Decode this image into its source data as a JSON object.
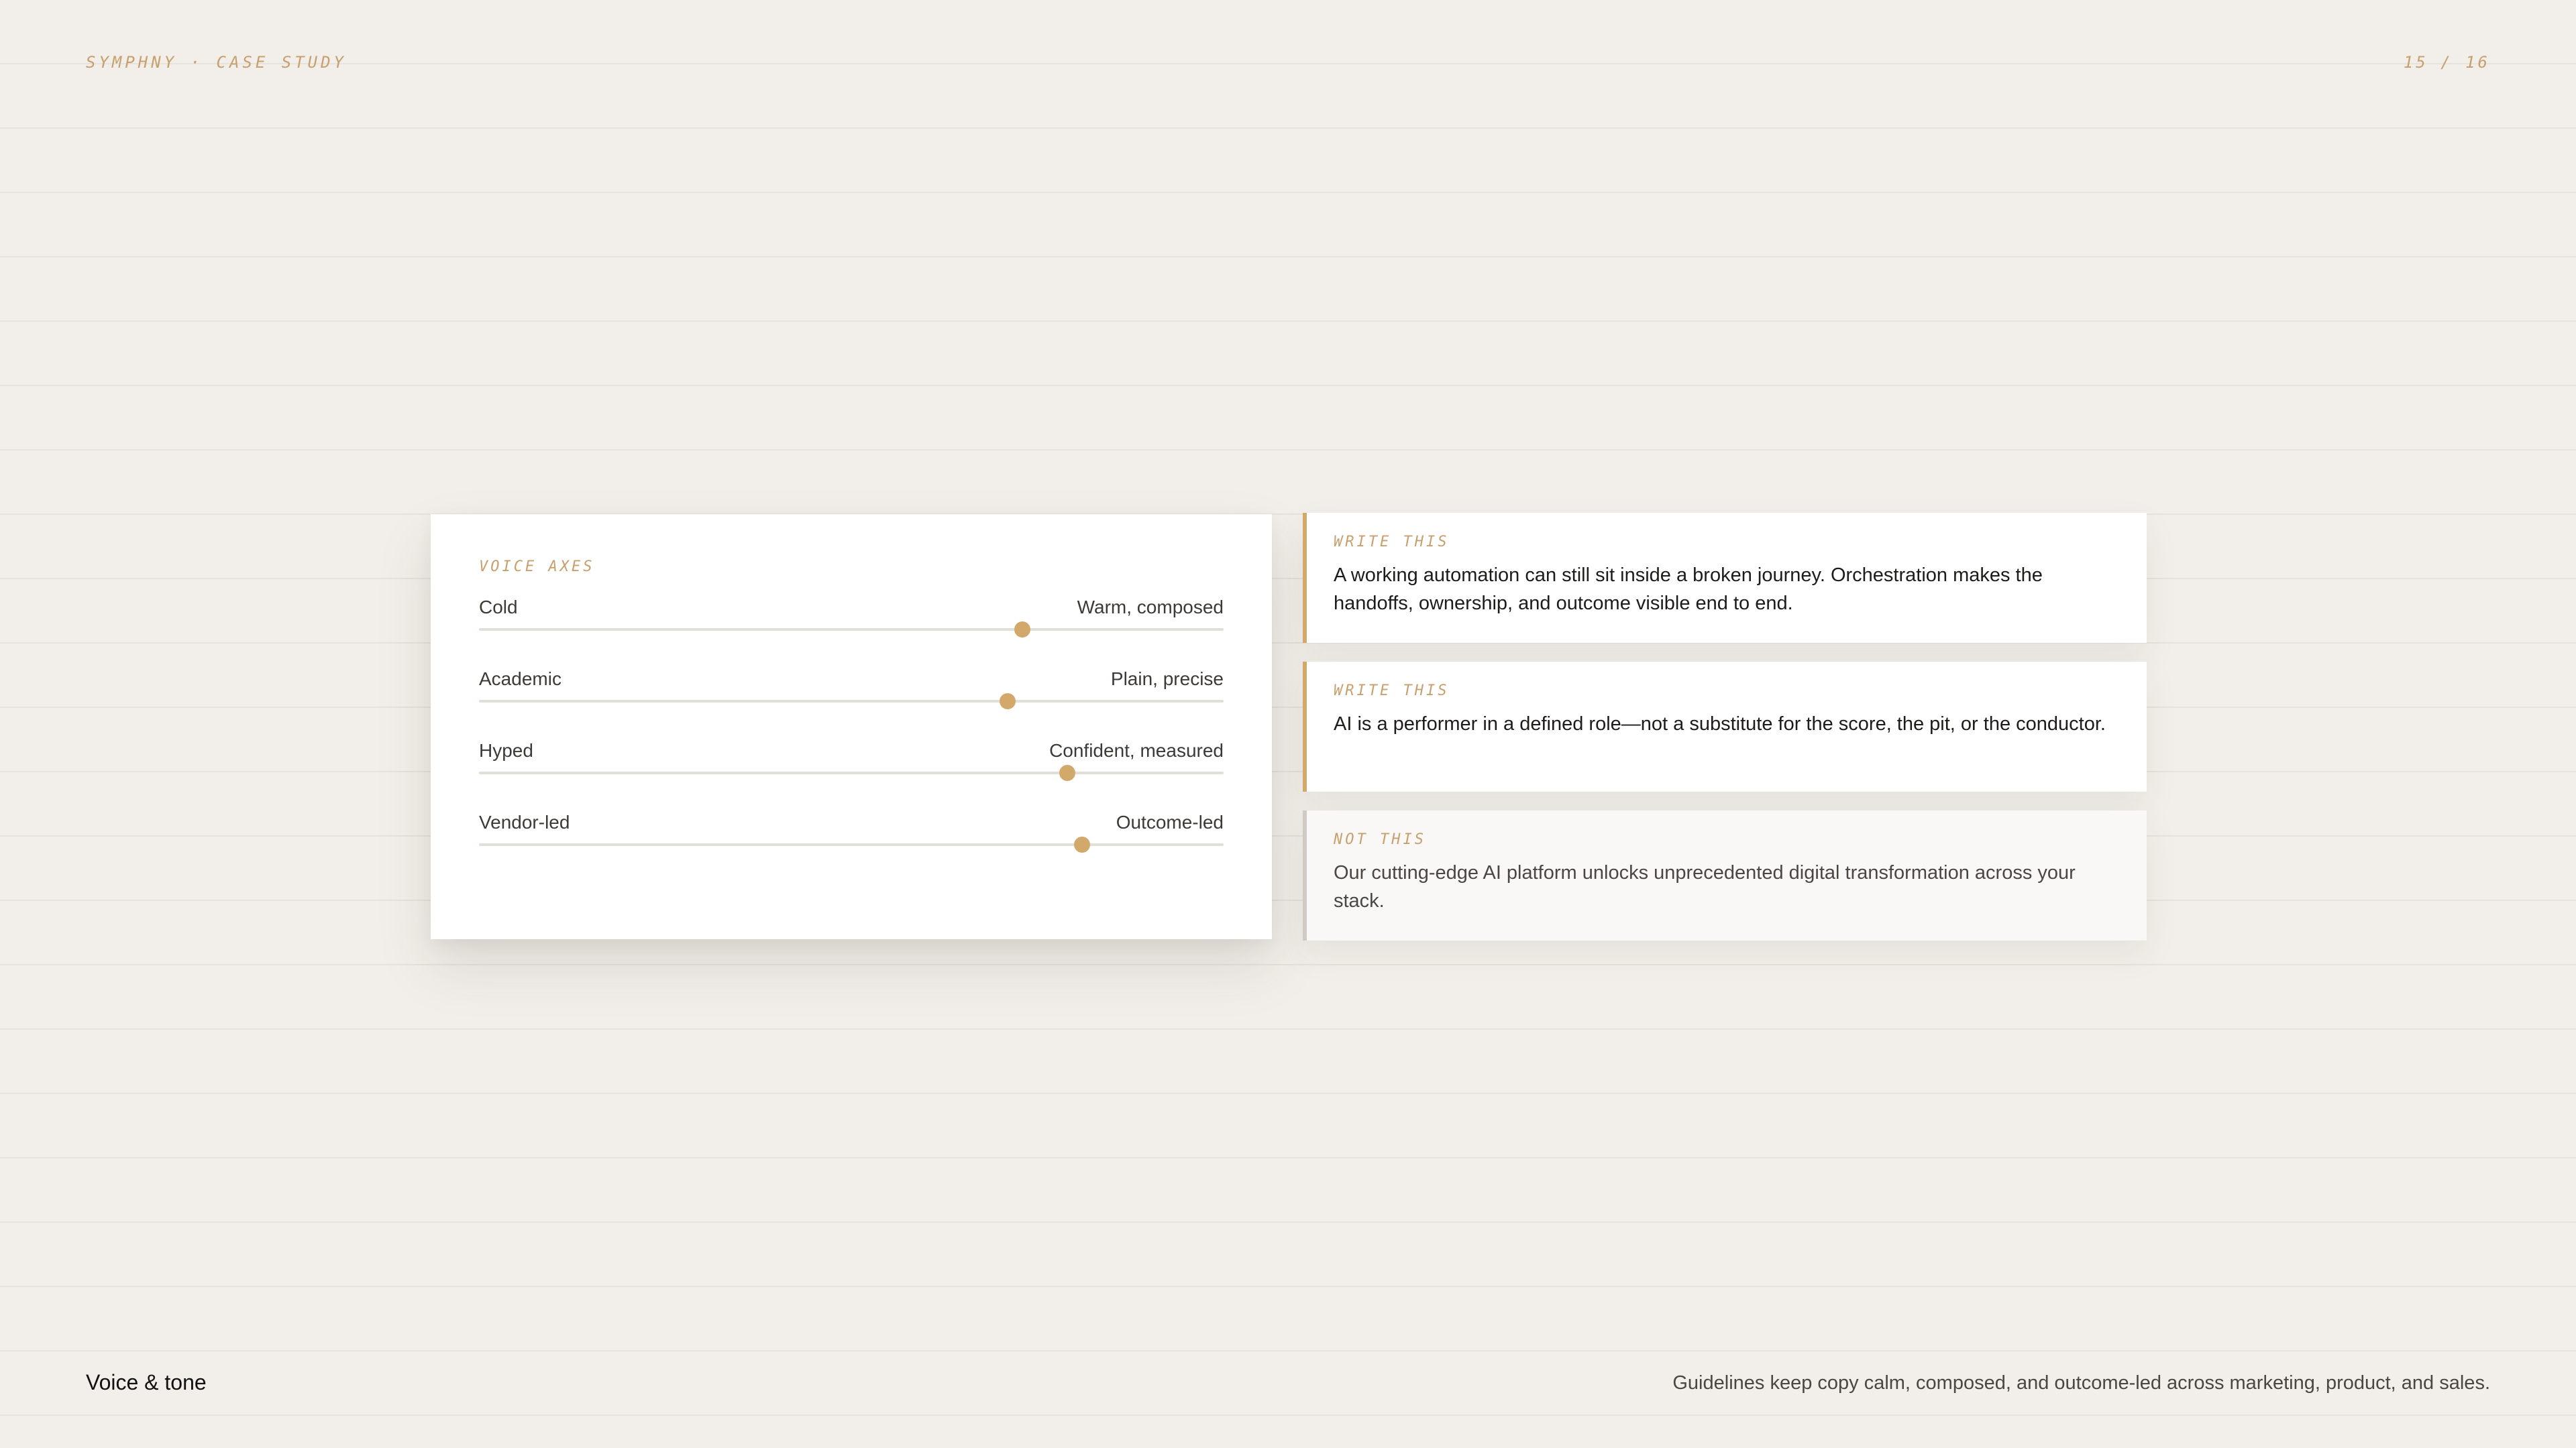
{
  "header": {
    "deck_label": "SYMPHNY · CASE STUDY",
    "page_indicator": "15 / 16"
  },
  "voice_axes": {
    "label": "VOICE AXES",
    "axes": [
      {
        "left": "Cold",
        "right": "Warm, composed",
        "value": 0.73
      },
      {
        "left": "Academic",
        "right": "Plain, precise",
        "value": 0.71
      },
      {
        "left": "Hyped",
        "right": "Confident, measured",
        "value": 0.79
      },
      {
        "left": "Vendor-led",
        "right": "Outcome-led",
        "value": 0.81
      }
    ]
  },
  "examples": [
    {
      "label": "WRITE THIS",
      "text": "A working automation can still sit inside a broken journey. Orchestration makes the handoffs, ownership, and outcome visible end to end."
    },
    {
      "label": "WRITE THIS",
      "text": "AI is a performer in a defined role—not a substitute for the score, the pit, or the conductor."
    },
    {
      "label": "NOT THIS",
      "text": "Our cutting-edge AI platform unlocks unprecedented digital transformation across your stack."
    }
  ],
  "footer": {
    "title": "Voice & tone",
    "description": "Guidelines keep copy calm, composed, and outcome-led across marketing, product, and sales."
  },
  "colors": {
    "background": "#f2efea",
    "accent": "#d3a86b",
    "muted_border": "#cfcac4"
  }
}
